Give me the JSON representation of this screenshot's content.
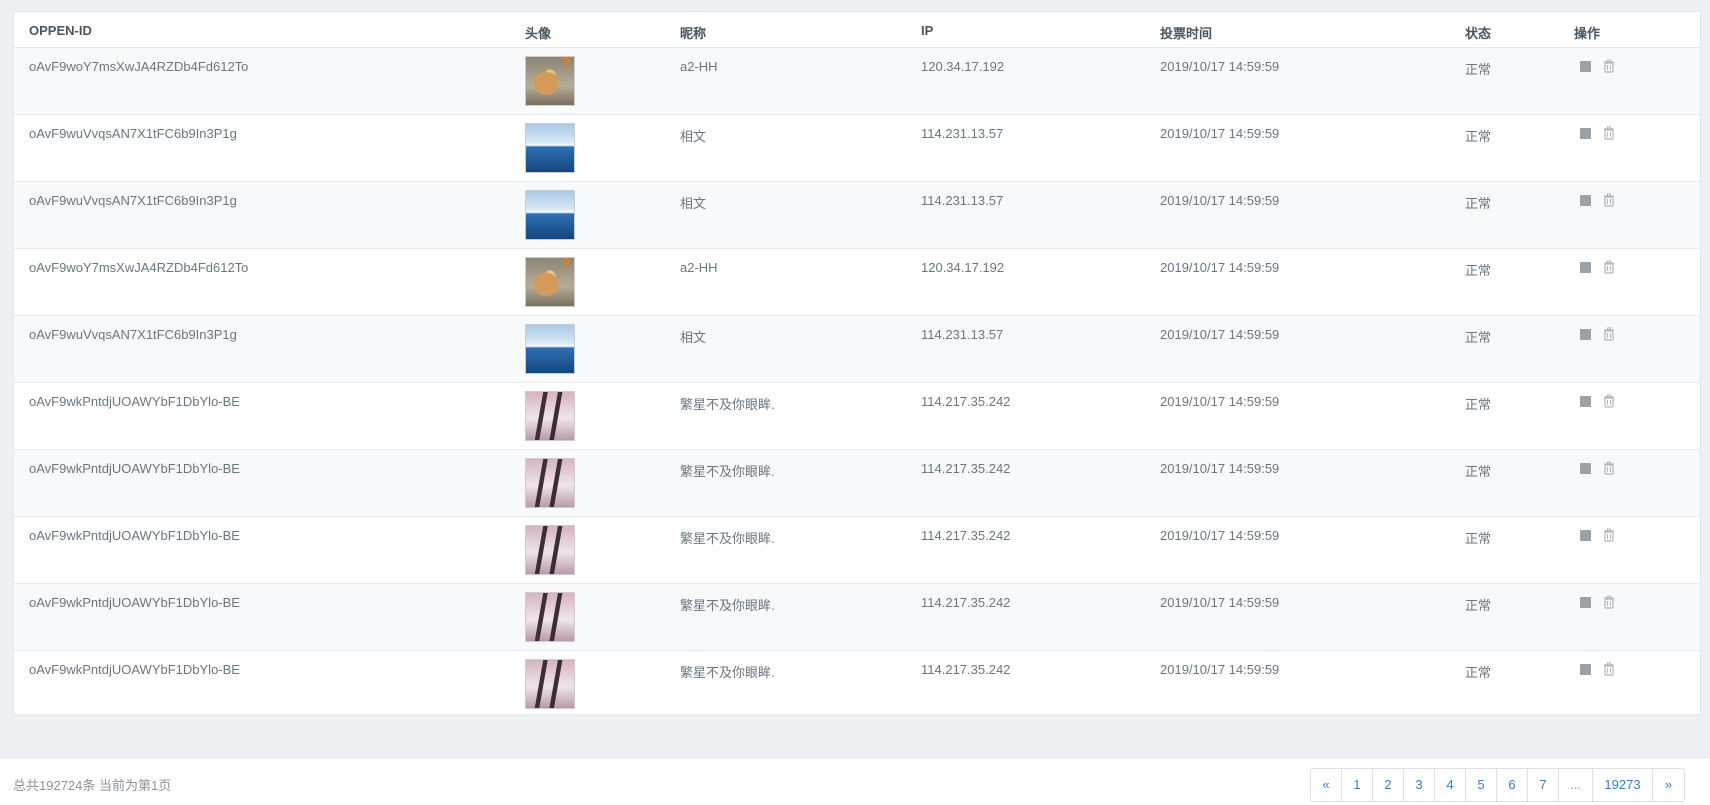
{
  "table": {
    "headers": [
      "OPPEN-ID",
      "头像",
      "昵称",
      "IP",
      "投票时间",
      "状态",
      "操作"
    ],
    "rows": [
      {
        "openid": "oAvF9woY7msXwJA4RZDb4Fd612To",
        "avatar": "dog",
        "nickname": "a2-HH",
        "ip": "120.34.17.192",
        "time": "2019/10/17 14:59:59",
        "status": "正常"
      },
      {
        "openid": "oAvF9wuVvqsAN7X1tFC6b9In3P1g",
        "avatar": "iceberg",
        "nickname": "相文",
        "ip": "114.231.13.57",
        "time": "2019/10/17 14:59:59",
        "status": "正常"
      },
      {
        "openid": "oAvF9wuVvqsAN7X1tFC6b9In3P1g",
        "avatar": "iceberg",
        "nickname": "相文",
        "ip": "114.231.13.57",
        "time": "2019/10/17 14:59:59",
        "status": "正常"
      },
      {
        "openid": "oAvF9woY7msXwJA4RZDb4Fd612To",
        "avatar": "dog",
        "nickname": "a2-HH",
        "ip": "120.34.17.192",
        "time": "2019/10/17 14:59:59",
        "status": "正常"
      },
      {
        "openid": "oAvF9wuVvqsAN7X1tFC6b9In3P1g",
        "avatar": "iceberg",
        "nickname": "相文",
        "ip": "114.231.13.57",
        "time": "2019/10/17 14:59:59",
        "status": "正常"
      },
      {
        "openid": "oAvF9wkPntdjUOAWYbF1DbYlo-BE",
        "avatar": "anime",
        "nickname": "繁星不及你眼眸.",
        "ip": "114.217.35.242",
        "time": "2019/10/17 14:59:59",
        "status": "正常"
      },
      {
        "openid": "oAvF9wkPntdjUOAWYbF1DbYlo-BE",
        "avatar": "anime",
        "nickname": "繁星不及你眼眸.",
        "ip": "114.217.35.242",
        "time": "2019/10/17 14:59:59",
        "status": "正常"
      },
      {
        "openid": "oAvF9wkPntdjUOAWYbF1DbYlo-BE",
        "avatar": "anime",
        "nickname": "繁星不及你眼眸.",
        "ip": "114.217.35.242",
        "time": "2019/10/17 14:59:59",
        "status": "正常"
      },
      {
        "openid": "oAvF9wkPntdjUOAWYbF1DbYlo-BE",
        "avatar": "anime",
        "nickname": "繁星不及你眼眸.",
        "ip": "114.217.35.242",
        "time": "2019/10/17 14:59:59",
        "status": "正常"
      },
      {
        "openid": "oAvF9wkPntdjUOAWYbF1DbYlo-BE",
        "avatar": "anime",
        "nickname": "繁星不及你眼眸.",
        "ip": "114.217.35.242",
        "time": "2019/10/17 14:59:59",
        "status": "正常"
      }
    ],
    "actions": {
      "edit_icon": "square-icon",
      "delete_icon": "trash-icon"
    }
  },
  "footer": {
    "summary": "总共192724条 当前为第1页",
    "pagination": [
      "«",
      "1",
      "2",
      "3",
      "4",
      "5",
      "6",
      "7",
      "...",
      "19273",
      "»"
    ]
  },
  "colors": {
    "link": "#3a7cc4",
    "icon": "#9aa1a7",
    "stripe": "#f8f9fa"
  }
}
